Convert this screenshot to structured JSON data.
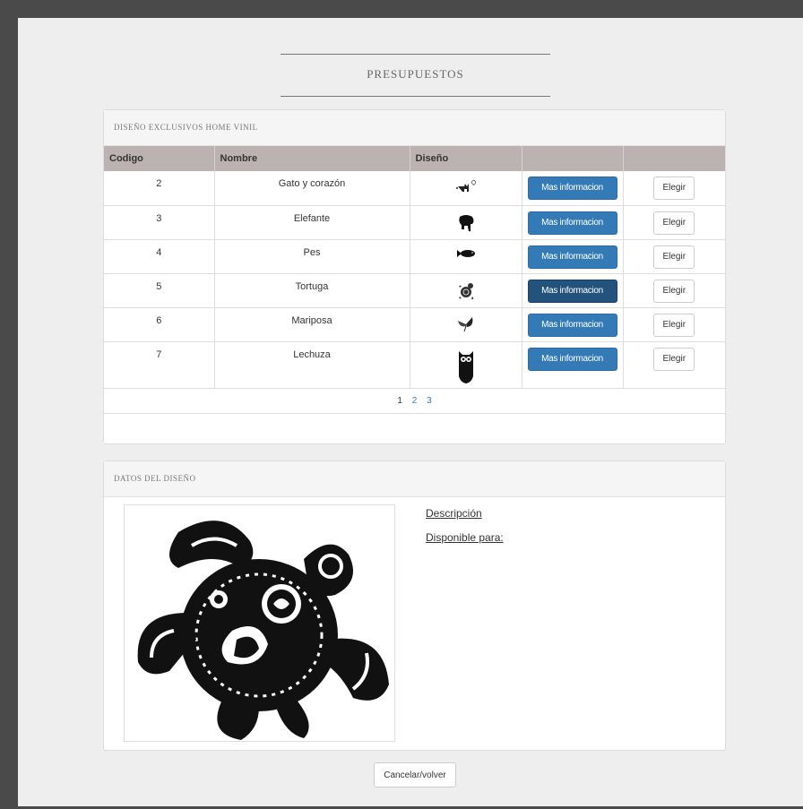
{
  "page": {
    "title": "PRESUPUESTOS"
  },
  "catalog": {
    "heading": "DISEÑO EXCLUSIVOS HOME VINIL",
    "columns": [
      "Codigo",
      "Nombre",
      "Diseño",
      "",
      ""
    ],
    "info_button_label": "Mas informacion",
    "choose_button_label": "Elegir",
    "rows": [
      {
        "codigo": "2",
        "nombre": "Gato y corazón",
        "icon": "cat-heart-icon"
      },
      {
        "codigo": "3",
        "nombre": "Elefante",
        "icon": "elephant-icon"
      },
      {
        "codigo": "4",
        "nombre": "Pes",
        "icon": "fish-icon"
      },
      {
        "codigo": "5",
        "nombre": "Tortuga",
        "icon": "turtle-icon"
      },
      {
        "codigo": "6",
        "nombre": "Mariposa",
        "icon": "butterfly-icon"
      },
      {
        "codigo": "7",
        "nombre": "Lechuza",
        "icon": "owl-icon"
      }
    ],
    "pagination": {
      "pages": [
        "1",
        "2",
        "3"
      ],
      "current": "1"
    }
  },
  "details": {
    "heading": "DATOS DEL DISEÑO",
    "description_label": "Descripción",
    "available_label": "Disponible para:",
    "image": "turtle-tribal-image"
  },
  "footer": {
    "cancel_label": "Cancelar/volver"
  }
}
